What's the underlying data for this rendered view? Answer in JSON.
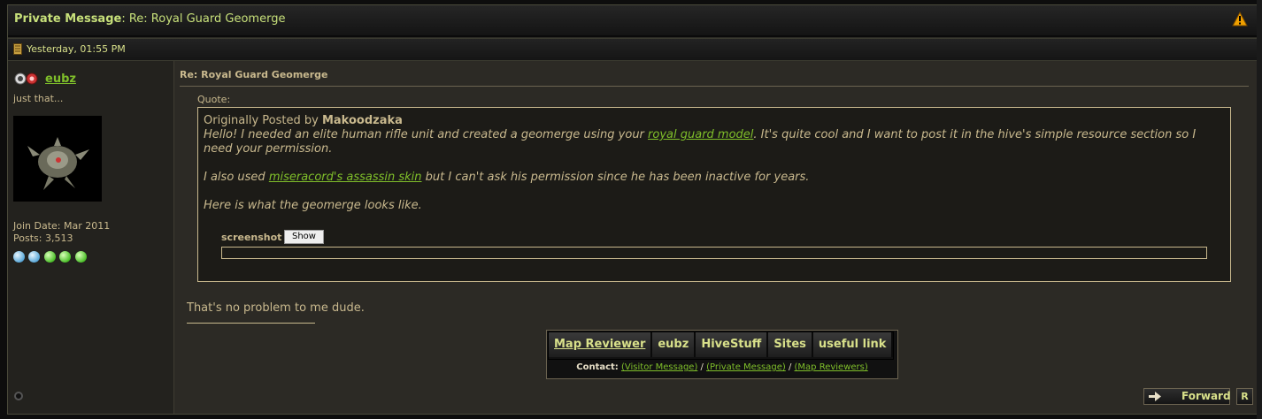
{
  "window": {
    "title_prefix": "Private Message",
    "title_rest": ": Re: Royal Guard Geomerge"
  },
  "post_header": {
    "date": "Yesterday, 01:55 PM"
  },
  "user": {
    "name": "eubz",
    "title": "just that...",
    "join_date": "Join Date: Mar 2011",
    "posts": "Posts: 3,513",
    "reputation_dots": 5
  },
  "message": {
    "title": "Re: Royal Guard Geomerge",
    "quote_label": "Quote:",
    "quote_prefix": "Originally Posted by ",
    "quote_author": "Makoodzaka",
    "quote_p1_before": "Hello! I needed an elite human rifle unit and created a geomerge using your ",
    "quote_p1_link": "royal guard model",
    "quote_p1_after": ". It's quite cool and I want to post it in the hive's simple resource section so I need your permission.",
    "quote_p2_before": "I also used ",
    "quote_p2_link": "miseracord's assassin skin",
    "quote_p2_after": " but I can't ask his permission since he has been inactive for years.",
    "quote_p3": "Here is what the geomerge looks like.",
    "spoiler_label": "screenshot",
    "spoiler_button": "Show",
    "reply": "That's no problem to me dude."
  },
  "signature": {
    "tabs": [
      "Map Reviewer",
      "eubz",
      "HiveStuff",
      "Sites",
      "useful link"
    ],
    "contact_label": "Contact:",
    "contact_links": [
      "(Visitor Message)",
      "(Private Message)",
      "(Map Reviewers)"
    ],
    "contact_sep": " / "
  },
  "actions": {
    "forward": "Forward",
    "r": "R"
  },
  "colors": {
    "accent_green": "#7fbf2a",
    "text_tan": "#c9b98e",
    "title_green": "#c7e07a",
    "warning_orange": "#f0a000"
  },
  "icons": [
    "warning-icon",
    "calendar-icon",
    "user-rank-icon",
    "online-status-icon",
    "forward-arrow-icon"
  ]
}
